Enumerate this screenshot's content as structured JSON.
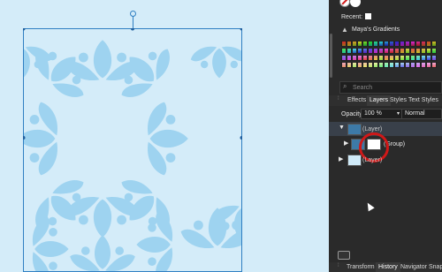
{
  "canvas": {
    "background": "#d4ecf9",
    "pattern_color": "#9ed3f0",
    "selection_color": "#2f7fc2"
  },
  "swatches": {
    "recent_label": "Recent:",
    "palette_name": "Maya's Gradients"
  },
  "search": {
    "placeholder": "Search"
  },
  "layer_tabs": [
    "Effects",
    "Layers",
    "Styles",
    "Text Styles"
  ],
  "layer_controls": {
    "opacity_label": "Opacity:",
    "opacity_value": "100 %",
    "blend_mode": "Normal"
  },
  "layers": [
    {
      "name": "(Layer)"
    },
    {
      "name": "(Group)"
    },
    {
      "name": "(Layer)"
    }
  ],
  "bottom_tabs": [
    "Transform",
    "History",
    "Navigator",
    "Snap"
  ],
  "colors": {
    "panel_bg": "#2a2a2a",
    "highlight_ring": "#d01818"
  }
}
